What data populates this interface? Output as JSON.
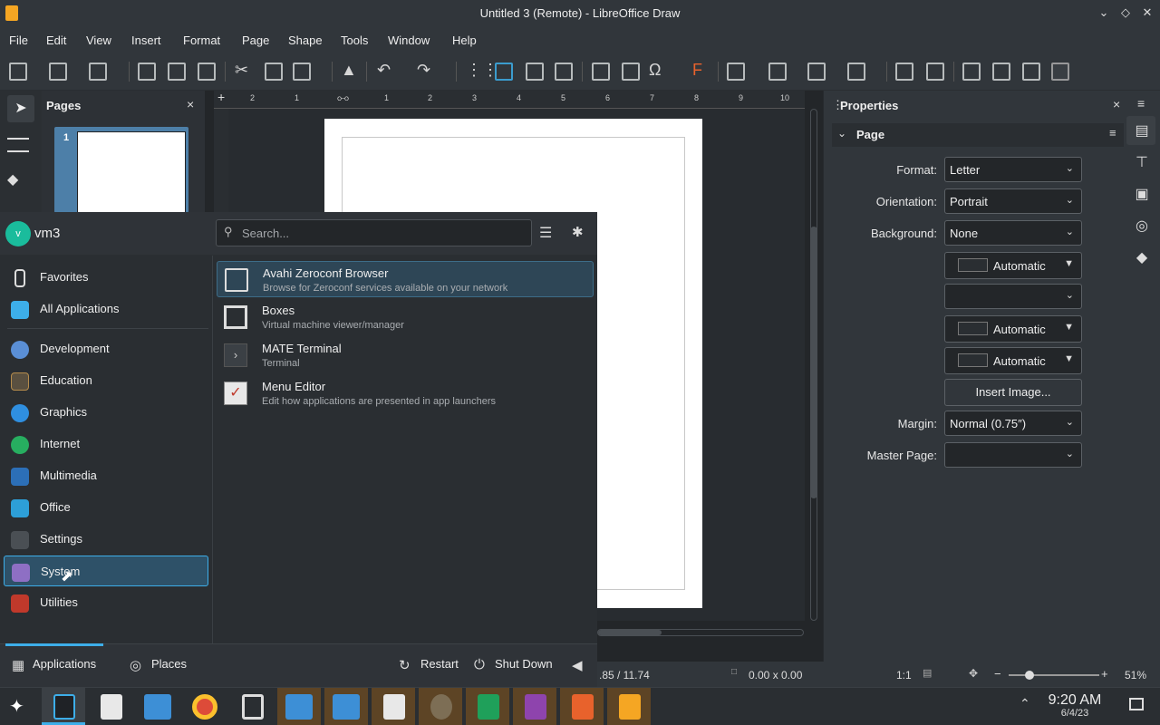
{
  "window": {
    "title": "Untitled 3 (Remote) - LibreOffice Draw"
  },
  "menubar": [
    "File",
    "Edit",
    "View",
    "Insert",
    "Format",
    "Page",
    "Shape",
    "Tools",
    "Window",
    "Help"
  ],
  "pages_panel": {
    "title": "Pages",
    "close": "×",
    "thumb_number": "1"
  },
  "ruler": {
    "ticks": [
      "2",
      "1",
      "1",
      "2",
      "3",
      "4",
      "5",
      "6",
      "7",
      "8",
      "9",
      "10"
    ]
  },
  "properties": {
    "title": "Properties",
    "close": "×",
    "section": "Page",
    "format_label": "Format:",
    "format_value": "Letter",
    "orientation_label": "Orientation:",
    "orientation_value": "Portrait",
    "background_label": "Background:",
    "background_value": "None",
    "color1": "Automatic",
    "color2": "Automatic",
    "color3": "Automatic",
    "insert_image": "Insert Image...",
    "margin_label": "Margin:",
    "margin_value": "Normal (0.75″)",
    "master_page_label": "Master Page:",
    "master_page_value": ""
  },
  "statusbar": {
    "position": ".85 / 11.74",
    "size": "0.00 x 0.00",
    "scale": "1:1",
    "zoom": "51%"
  },
  "launcher": {
    "user_initial": "v",
    "username": "vm3",
    "search_placeholder": "Search...",
    "categories": [
      {
        "label": "Favorites",
        "icon": "bookmark-icon"
      },
      {
        "label": "All Applications",
        "icon": "grid-icon"
      },
      {
        "label": "Development",
        "icon": "development-icon"
      },
      {
        "label": "Education",
        "icon": "education-icon"
      },
      {
        "label": "Graphics",
        "icon": "graphics-icon"
      },
      {
        "label": "Internet",
        "icon": "globe-icon"
      },
      {
        "label": "Multimedia",
        "icon": "multimedia-icon"
      },
      {
        "label": "Office",
        "icon": "office-icon"
      },
      {
        "label": "Settings",
        "icon": "settings-icon"
      },
      {
        "label": "System",
        "icon": "system-icon"
      },
      {
        "label": "Utilities",
        "icon": "utilities-icon"
      }
    ],
    "selected_category": "System",
    "apps": [
      {
        "name": "Avahi Zeroconf Browser",
        "desc": "Browse for Zeroconf services available on your network"
      },
      {
        "name": "Boxes",
        "desc": "Virtual machine viewer/manager"
      },
      {
        "name": "MATE Terminal",
        "desc": "Terminal"
      },
      {
        "name": "Menu Editor",
        "desc": "Edit how applications are presented in app launchers"
      }
    ],
    "footer": {
      "applications": "Applications",
      "places": "Places",
      "restart": "Restart",
      "shutdown": "Shut Down"
    }
  },
  "taskbar": {
    "time": "9:20 AM",
    "date": "6/4/23"
  },
  "colors": {
    "accent": "#3daee9",
    "panel": "#31363b",
    "background": "#232629"
  }
}
